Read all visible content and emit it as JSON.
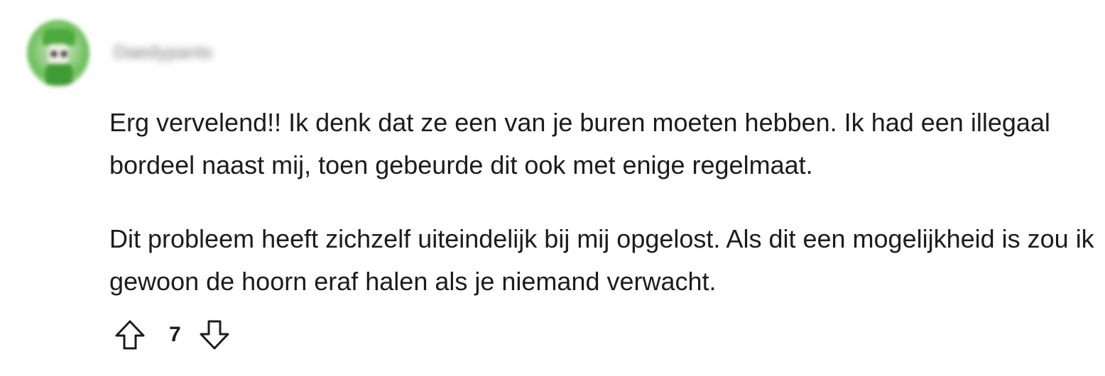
{
  "comment": {
    "username": "Daedypants",
    "paragraphs": [
      "Erg vervelend!! Ik denk dat ze een van je buren moeten hebben. Ik had een illegaal bordeel naast mij, toen gebeurde dit ook met enige regelmaat.",
      "Dit probleem heeft zichzelf uiteindelijk bij mij opgelost. Als dit een mogelijkheid is zou ik gewoon de hoorn eraf halen als je niemand verwacht."
    ],
    "score": "7"
  },
  "icons": {
    "upvote": "arrow-up-outline-icon",
    "downvote": "arrow-down-outline-icon"
  },
  "colors": {
    "text": "#1c1c1c",
    "background": "#ffffff"
  }
}
